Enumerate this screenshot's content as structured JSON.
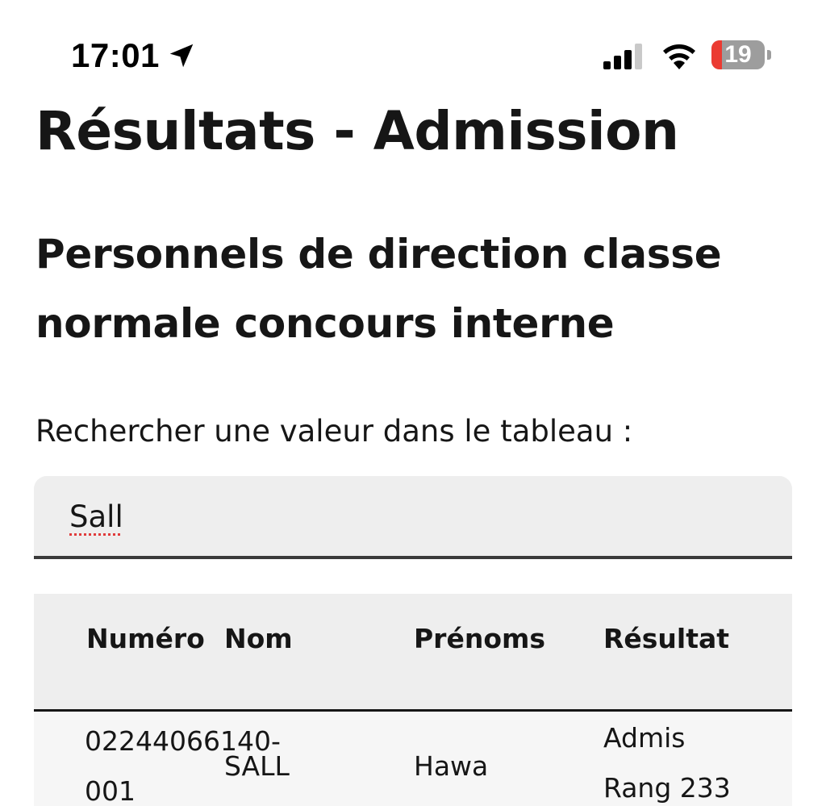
{
  "status_bar": {
    "time": "17:01",
    "battery_level": "19",
    "icons": [
      "location-arrow-icon",
      "cellular-signal-icon",
      "wifi-icon",
      "battery-icon"
    ],
    "battery_color": "#eb3b32"
  },
  "page": {
    "title": "Résultats - Admission",
    "section_title": "Personnels de direction classe normale concours interne"
  },
  "search": {
    "label": "Rechercher une valeur dans le tableau :",
    "value": "Sall"
  },
  "table": {
    "headers": {
      "numero": "Numéro",
      "nom": "Nom",
      "prenoms": "Prénoms",
      "resultat": "Résultat"
    },
    "rows": [
      {
        "numero_line1": "02244066140-",
        "numero_line2": "001",
        "nom": "SALL",
        "prenoms": "Hawa",
        "resultat_line1": "Admis",
        "resultat_line2": "Rang 233"
      }
    ]
  },
  "colors": {
    "text": "#161616",
    "table_header_bg": "#eeeeee",
    "row_bg": "#f6f6f6"
  }
}
